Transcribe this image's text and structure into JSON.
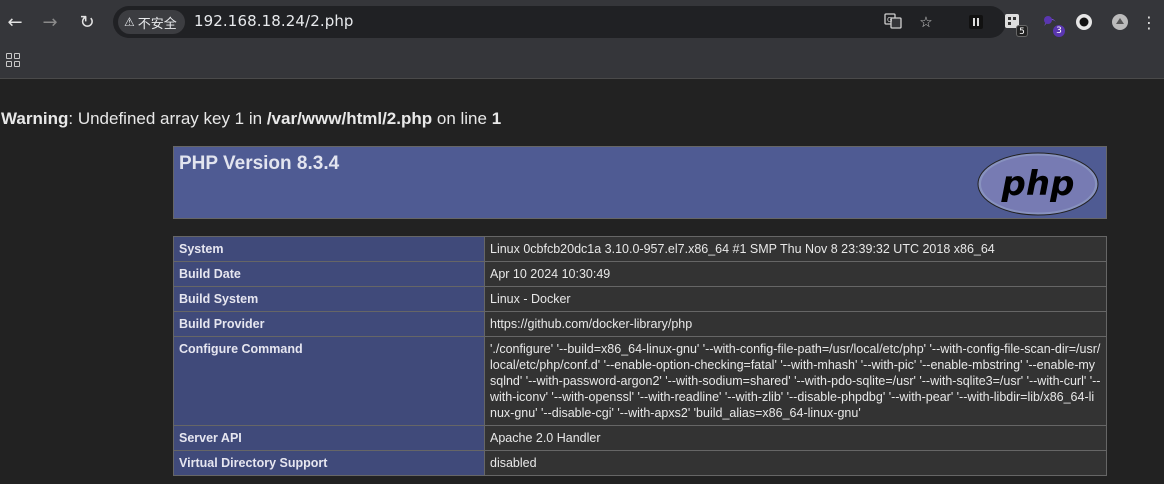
{
  "browser": {
    "url": "192.168.18.24/2.php",
    "security_label": "不安全",
    "extensions": [
      {
        "name": "extension-1",
        "badge": ""
      },
      {
        "name": "extension-2",
        "badge": "5"
      },
      {
        "name": "extension-3",
        "badge": "3"
      },
      {
        "name": "extension-4",
        "badge": ""
      },
      {
        "name": "extension-5",
        "badge": ""
      }
    ]
  },
  "warning": {
    "label": "Warning",
    "message": ": Undefined array key 1 in ",
    "path": "/var/www/html/2.php",
    "on_line": " on line ",
    "line": "1"
  },
  "phpinfo": {
    "title": "PHP Version 8.3.4",
    "logo_text": "php",
    "rows": [
      {
        "key": "System",
        "value": "Linux 0cbfcb20dc1a 3.10.0-957.el7.x86_64 #1 SMP Thu Nov 8 23:39:32 UTC 2018 x86_64"
      },
      {
        "key": "Build Date",
        "value": "Apr 10 2024 10:30:49"
      },
      {
        "key": "Build System",
        "value": "Linux - Docker"
      },
      {
        "key": "Build Provider",
        "value": "https://github.com/docker-library/php"
      },
      {
        "key": "Configure Command",
        "value": "'./configure' '--build=x86_64-linux-gnu' '--with-config-file-path=/usr/local/etc/php' '--with-config-file-scan-dir=/usr/local/etc/php/conf.d' '--enable-option-checking=fatal' '--with-mhash' '--with-pic' '--enable-mbstring' '--enable-mysqlnd' '--with-password-argon2' '--with-sodium=shared' '--with-pdo-sqlite=/usr' '--with-sqlite3=/usr' '--with-curl' '--with-iconv' '--with-openssl' '--with-readline' '--with-zlib' '--disable-phpdbg' '--with-pear' '--with-libdir=lib/x86_64-linux-gnu' '--disable-cgi' '--with-apxs2' 'build_alias=x86_64-linux-gnu'"
      },
      {
        "key": "Server API",
        "value": "Apache 2.0 Handler"
      },
      {
        "key": "Virtual Directory Support",
        "value": "disabled"
      }
    ]
  },
  "colors": {
    "header_bg": "#4f5b93",
    "key_cell_bg": "#404a7a",
    "value_cell_bg": "#333333",
    "page_bg": "#222222"
  }
}
